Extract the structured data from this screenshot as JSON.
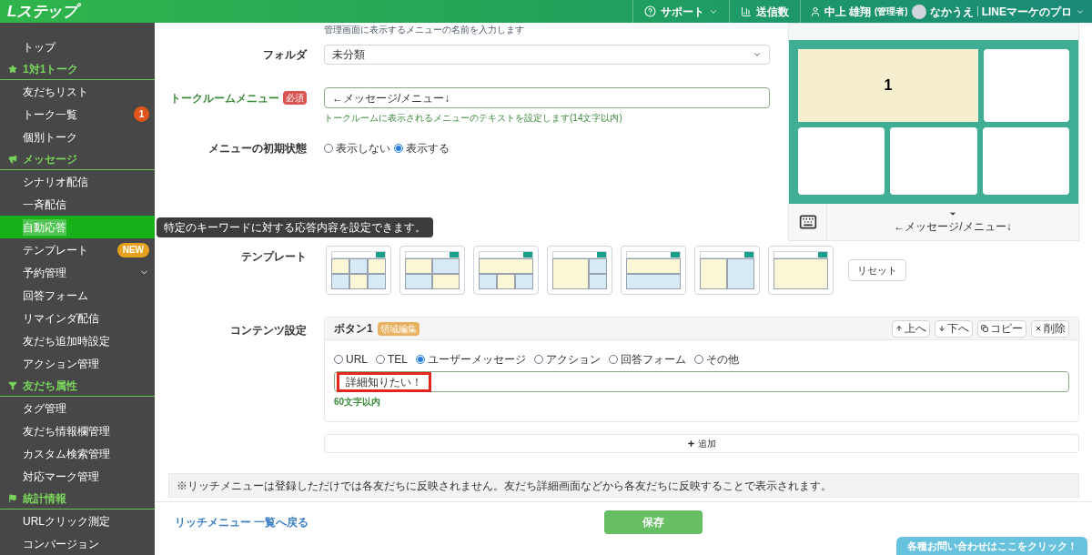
{
  "header": {
    "logo": "Lステップ",
    "menus": [
      {
        "kind": "support",
        "label": "サポート"
      },
      {
        "kind": "count",
        "label": "送信数"
      }
    ],
    "user": {
      "name": "中上 雄翔",
      "role": "(管理者)",
      "account": "なかうえ",
      "org": "LINEマーケのプロ"
    }
  },
  "sidebar": {
    "items": [
      {
        "kind": "item",
        "label": "トップ",
        "selected": false
      },
      {
        "kind": "section",
        "label": "1対1トーク"
      },
      {
        "kind": "item",
        "label": "友だちリスト",
        "selected": false
      },
      {
        "kind": "item",
        "label": "トーク一覧",
        "selected": false,
        "count": "1"
      },
      {
        "kind": "item",
        "label": "個別トーク",
        "selected": false
      },
      {
        "kind": "section",
        "label": "メッセージ"
      },
      {
        "kind": "item",
        "label": "シナリオ配信",
        "selected": false
      },
      {
        "kind": "item",
        "label": "一斉配信",
        "selected": false
      },
      {
        "kind": "item",
        "label": "自動応答",
        "selected": true
      },
      {
        "kind": "item",
        "label": "テンプレート",
        "selected": false,
        "badge": "NEW"
      },
      {
        "kind": "item",
        "label": "予約管理",
        "selected": false,
        "expandable": true
      },
      {
        "kind": "item",
        "label": "回答フォーム",
        "selected": false
      },
      {
        "kind": "item",
        "label": "リマインダ配信",
        "selected": false
      },
      {
        "kind": "item",
        "label": "友だち追加時設定",
        "selected": false
      },
      {
        "kind": "item",
        "label": "アクション管理",
        "selected": false
      },
      {
        "kind": "section",
        "label": "友だち属性"
      },
      {
        "kind": "item",
        "label": "タグ管理",
        "selected": false
      },
      {
        "kind": "item",
        "label": "友だち情報欄管理",
        "selected": false
      },
      {
        "kind": "item",
        "label": "カスタム検索管理",
        "selected": false
      },
      {
        "kind": "item",
        "label": "対応マーク管理",
        "selected": false
      },
      {
        "kind": "section",
        "label": "統計情報"
      },
      {
        "kind": "item",
        "label": "URLクリック測定",
        "selected": false
      },
      {
        "kind": "item",
        "label": "コンバージョン",
        "selected": false
      }
    ]
  },
  "tooltip": "特定のキーワードに対する応答内容を設定できます。",
  "form": {
    "top_hint": "管理画面に表示するメニューの名前を入力します",
    "folder": {
      "label": "フォルダ",
      "value": "未分類"
    },
    "talkroom_menu": {
      "label": "トークルームメニュー",
      "required": "必須",
      "value": "←メッセージ/メニュー↓",
      "help": "トークルームに表示されるメニューのテキストを設定します(14文字以内)"
    },
    "initial_state": {
      "label": "メニューの初期状態",
      "options": [
        {
          "label": "表示しない",
          "selected": false
        },
        {
          "label": "表示する",
          "selected": true
        }
      ]
    },
    "template": {
      "label": "テンプレート",
      "layouts": [
        {
          "kind": "grid6"
        },
        {
          "kind": "grid4"
        },
        {
          "kind": "top1bottom3"
        },
        {
          "kind": "left1right2"
        },
        {
          "kind": "top1bottom1"
        },
        {
          "kind": "left1right1"
        },
        {
          "kind": "single"
        }
      ],
      "reset": "リセット"
    },
    "contents": {
      "label": "コンテンツ設定",
      "button_title": "ボタン1",
      "area_edit": "領域編集",
      "actions": [
        {
          "kind": "up",
          "label": "上へ"
        },
        {
          "kind": "down",
          "label": "下へ"
        },
        {
          "kind": "copy",
          "label": "コピー"
        },
        {
          "kind": "delete",
          "label": "削除"
        }
      ],
      "types": [
        {
          "label": "URL",
          "selected": false
        },
        {
          "label": "TEL",
          "selected": false
        },
        {
          "label": "ユーザーメッセージ",
          "selected": true
        },
        {
          "label": "アクション",
          "selected": false
        },
        {
          "label": "回答フォーム",
          "selected": false
        },
        {
          "label": "その他",
          "selected": false
        }
      ],
      "message": "詳細知りたい！",
      "highlighted": true,
      "limit": "60文字以内",
      "add": "追加"
    }
  },
  "preview": {
    "area_label": "1",
    "menu_text": "←メッセージ/メニュー↓"
  },
  "notice": "※リッチメニューは登録しただけでは各友だちに反映されません。友だち詳細画面などから各友だちに反映することで表示されます。",
  "footer": {
    "back_link": "リッチメニュー 一覧へ戻る",
    "save": "保存",
    "contact": "各種お問い合わせはここをクリック！"
  }
}
